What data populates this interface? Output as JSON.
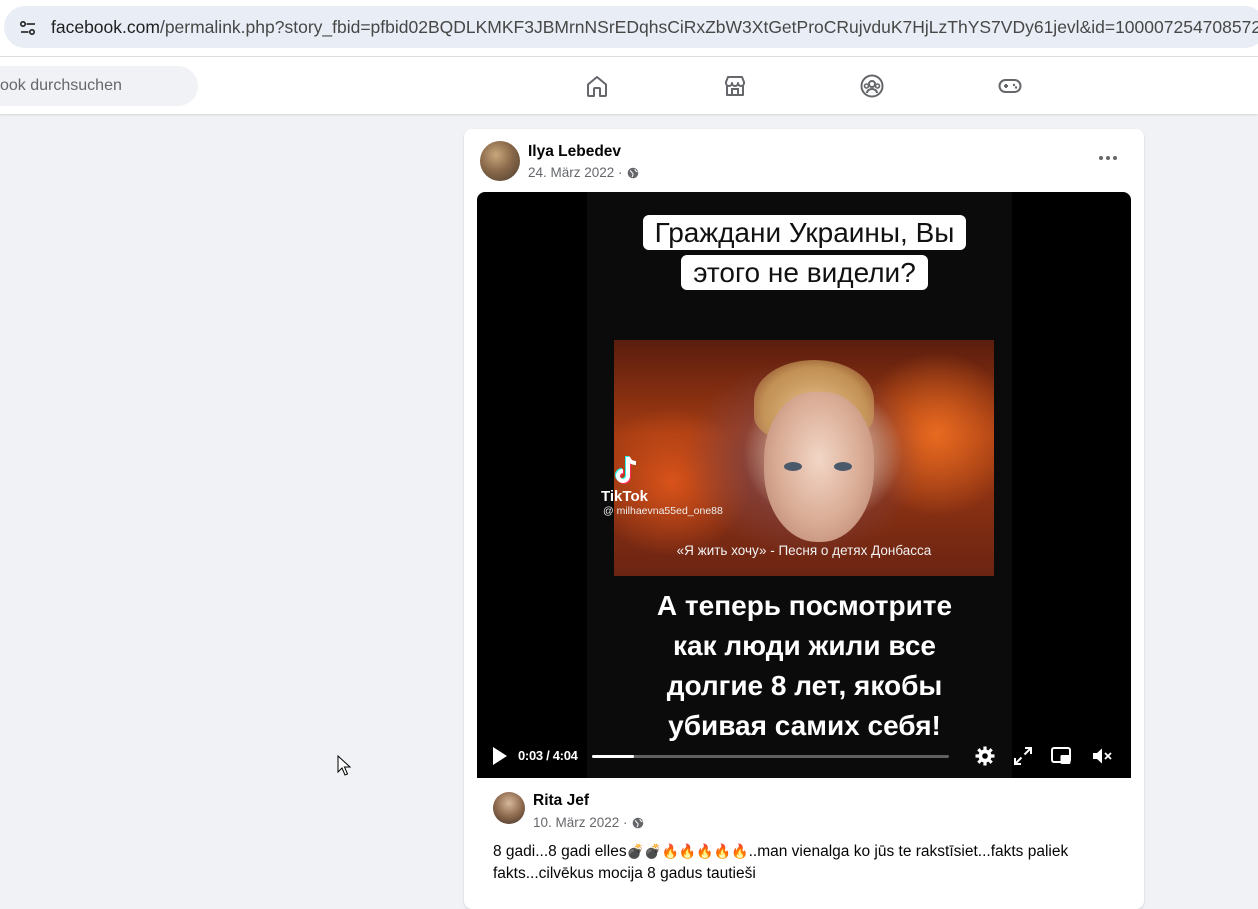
{
  "browser": {
    "url_host": "facebook.com",
    "url_path": "/permalink.php?story_fbid=pfbid02BQDLKMKF3JBMrnNSrEDqhsCiRxZbW3XtGetProCRujvduK7HjLzThYS7VDy61jevl&id=100007254708572"
  },
  "nav": {
    "search_placeholder": "ook durchsuchen",
    "tabs": [
      {
        "icon": "home-icon"
      },
      {
        "icon": "marketplace-icon"
      },
      {
        "icon": "groups-icon"
      },
      {
        "icon": "gaming-icon"
      }
    ]
  },
  "post": {
    "author": "Ilya Lebedev",
    "date": "24. März 2022 ·",
    "audience_icon": "globe-icon",
    "video": {
      "caption_top": [
        "Граждани Украины, Вы",
        "этого не видели?"
      ],
      "tiktok_label": "TikTok",
      "tiktok_handle": "@ milhaevna55ed_one88",
      "song_caption": "«Я жить хочу» - Песня о детях Донбасса",
      "caption_bottom": [
        "А теперь посмотрите",
        "как люди жили все",
        "долгие 8 лет, якобы",
        "убивая самих себя!"
      ],
      "time": "0:03 / 4:04",
      "progress_fraction": 0.012
    }
  },
  "comment": {
    "author": "Rita Jef",
    "date": "10. März 2022 ·",
    "text_part1": "8 gadi...8 gadi elles",
    "emojis": "💣💣🔥🔥🔥🔥🔥",
    "text_part2": "..man vienalga ko jūs te rakstīsiet...fakts paliek fakts...cilvēkus mocija 8 gadus tautieši"
  },
  "colors": {
    "page_bg": "#f0f2f5",
    "secondary_text": "#65676b",
    "primary_text": "#050505"
  }
}
